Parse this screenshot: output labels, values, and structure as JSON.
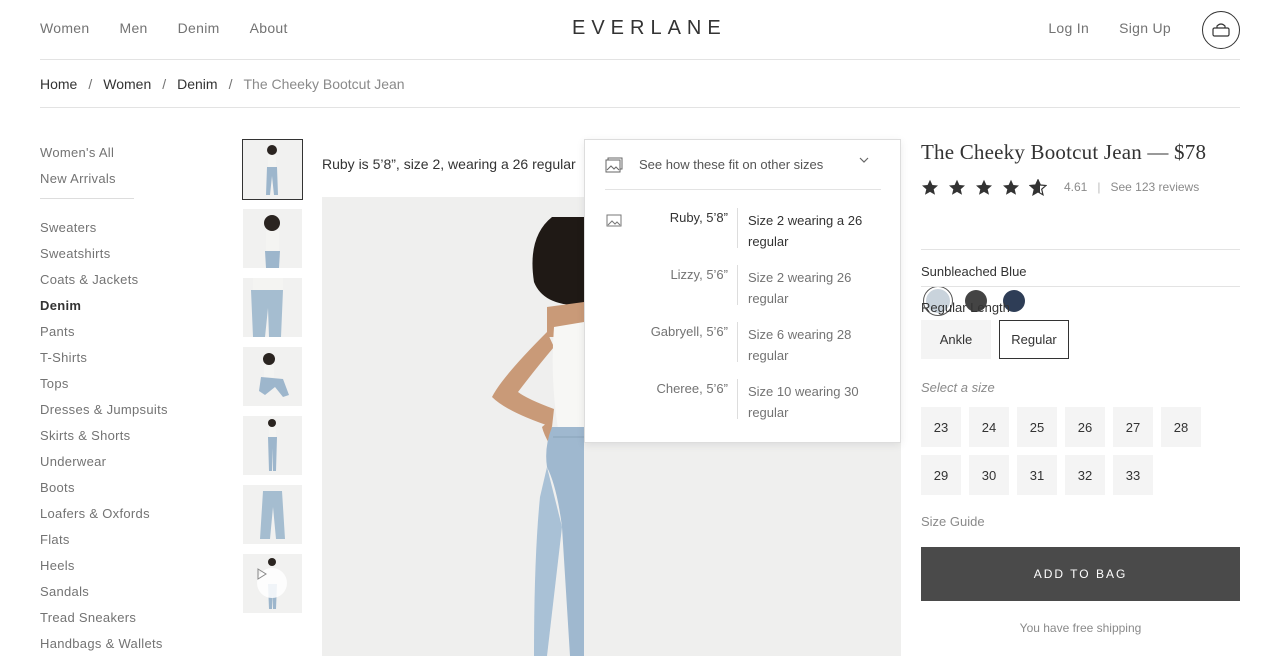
{
  "header": {
    "nav_left": [
      "Women",
      "Men",
      "Denim",
      "About"
    ],
    "logo": "EVERLANE",
    "nav_right": [
      "Log In",
      "Sign Up"
    ],
    "bag_icon": "shopping-bag-icon"
  },
  "breadcrumb": {
    "items": [
      "Home",
      "Women",
      "Denim"
    ],
    "separator": "/",
    "current": "The Cheeky Bootcut Jean"
  },
  "sidebar": {
    "top": [
      "Women's All",
      "New Arrivals"
    ],
    "categories": [
      "Sweaters",
      "Sweatshirts",
      "Coats & Jackets",
      "Denim",
      "Pants",
      "T-Shirts",
      "Tops",
      "Dresses & Jumpsuits",
      "Skirts & Shorts",
      "Underwear",
      "Boots",
      "Loafers & Oxfords",
      "Flats",
      "Heels",
      "Sandals",
      "Tread Sneakers",
      "Handbags & Wallets"
    ],
    "active": "Denim"
  },
  "gallery": {
    "model_note": "Ruby is 5’8”, size 2, wearing a 26 regular",
    "thumb_count": 7
  },
  "fit_popover": {
    "title": "See how these fit on other sizes",
    "rows": [
      {
        "name": "Ruby, 5’8”",
        "fit": "Size 2 wearing a 26 regular",
        "highlight": true
      },
      {
        "name": "Lizzy, 5’6”",
        "fit": "Size 2 wearing 26 regular",
        "highlight": false
      },
      {
        "name": "Gabryell, 5’6”",
        "fit": "Size 6 wearing 28 regular",
        "highlight": false
      },
      {
        "name": "Cheree, 5’6”",
        "fit": "Size 10 wearing 30 regular",
        "highlight": false
      }
    ]
  },
  "product": {
    "title": "The Cheeky Bootcut Jean — $78",
    "rating": "4.61",
    "reviews": "See 123 reviews",
    "stars_value": 4.61,
    "color_name": "Sunbleached Blue",
    "swatches": [
      "#c9d3dc",
      "#444444",
      "#2e3d56"
    ],
    "length_label": "Regular Length",
    "lengths": [
      "Ankle",
      "Regular"
    ],
    "selected_length": "Regular",
    "size_label": "Select a size",
    "sizes": [
      "23",
      "24",
      "25",
      "26",
      "27",
      "28",
      "29",
      "30",
      "31",
      "32",
      "33"
    ],
    "size_guide": "Size Guide",
    "add_to_bag": "ADD TO BAG",
    "shipping": "You have free shipping"
  },
  "colors": {
    "text": "#333333",
    "muted": "#737373",
    "button": "#4a4a4a"
  }
}
